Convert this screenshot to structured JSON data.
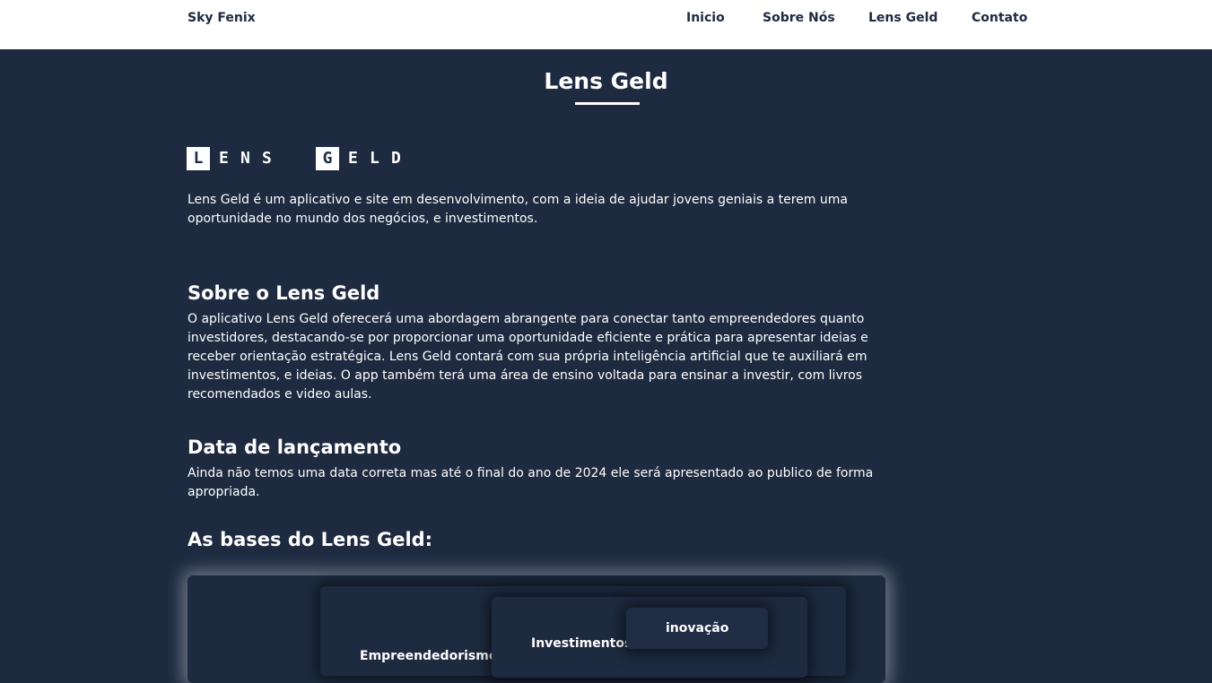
{
  "nav": {
    "brand": "Sky Fenix",
    "links": [
      "Inicio",
      "Sobre Nós",
      "Lens Geld",
      "Contato"
    ]
  },
  "page_title": "Lens Geld",
  "logo": {
    "letters": [
      "L",
      "E",
      "N",
      "S",
      "G",
      "E",
      "L",
      "D"
    ]
  },
  "intro": "Lens Geld é um aplicativo e site em desenvolvimento, com a ideia de ajudar jovens geniais a terem uma oportunidade no mundo dos negócios, e investimentos.",
  "sections": [
    {
      "heading": "Sobre o Lens Geld",
      "body": "O aplicativo Lens Geld oferecerá uma abordagem abrangente para conectar tanto empreendedores quanto investidores, destacando-se por proporcionar uma oportunidade eficiente e prática para apresentar ideias e receber orientação estratégica. Lens Geld contará com sua própria inteligência artificial que te auxiliará em investimentos, e ideias. O app também terá uma área de ensino voltada para ensinar a investir, com livros recomendados e video aulas."
    },
    {
      "heading": "Data de lançamento",
      "body": "Ainda não temos uma data correta mas até o final do ano de 2024 ele será apresentado ao publico de forma apropriada."
    }
  ],
  "bases": {
    "heading": "As bases do Lens Geld:",
    "cards": [
      "Empreendedorismo",
      "Investimentos",
      "inovação"
    ]
  },
  "colors": {
    "background": "#1d2a40",
    "nav_background": "#ffffff",
    "text": "#ffffff"
  }
}
